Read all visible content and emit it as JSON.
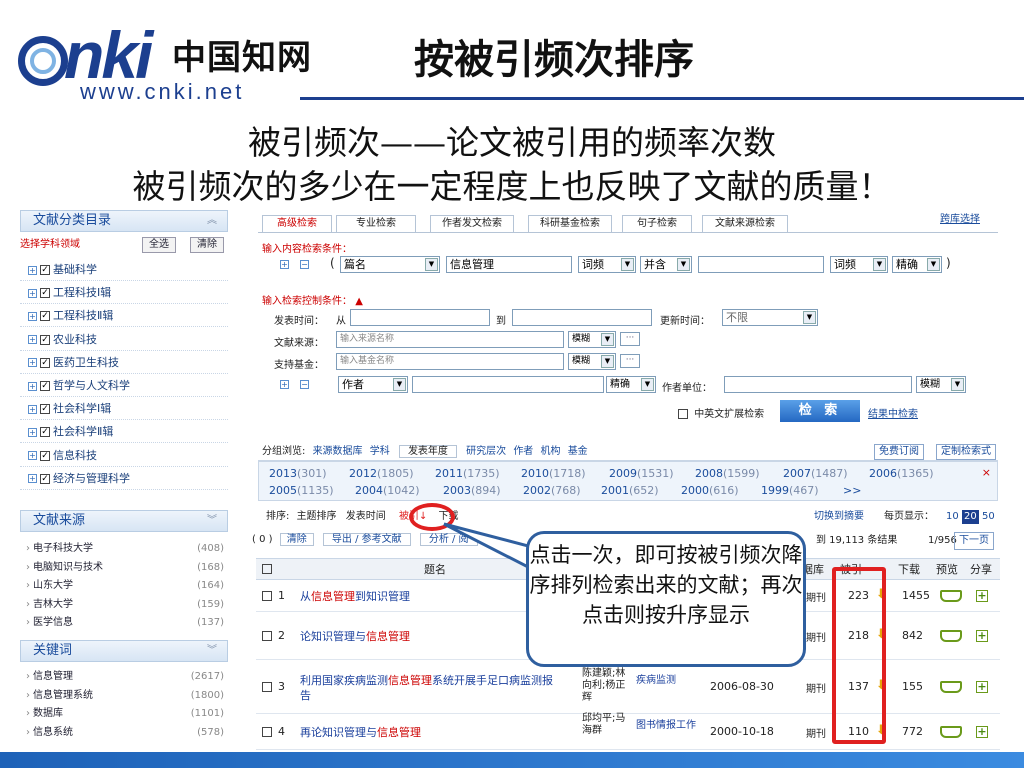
{
  "slide": {
    "logo_latin": "nki",
    "logo_chinese": "中国知网",
    "logo_url": "www.cnki.net",
    "title": "按被引频次排序",
    "subtitle_1": "被引频次——论文被引用的频率次数",
    "subtitle_2": "被引频次的多少在一定程度上也反映了文献的质量！",
    "callout": "点击一次，即可按被引频次降序排列检索出来的文献；再次点击则按升序显示"
  },
  "left_panel": {
    "category_title": "文献分类目录",
    "category_select_label": "选择学科领域",
    "select_all": "全选",
    "clear": "清除",
    "categories": [
      "基础科学",
      "工程科技Ⅰ辑",
      "工程科技Ⅱ辑",
      "农业科技",
      "医药卫生科技",
      "哲学与人文科学",
      "社会科学Ⅰ辑",
      "社会科学Ⅱ辑",
      "信息科技",
      "经济与管理科学"
    ],
    "source_title": "文献来源",
    "sources": [
      {
        "name": "电子科技大学",
        "count": "(408)"
      },
      {
        "name": "电脑知识与技术",
        "count": "(168)"
      },
      {
        "name": "山东大学",
        "count": "(164)"
      },
      {
        "name": "吉林大学",
        "count": "(159)"
      },
      {
        "name": "医学信息",
        "count": "(137)"
      }
    ],
    "keyword_title": "关键词",
    "keywords": [
      {
        "name": "信息管理",
        "count": "(2617)"
      },
      {
        "name": "信息管理系统",
        "count": "(1800)"
      },
      {
        "name": "数据库",
        "count": "(1101)"
      },
      {
        "name": "信息系统",
        "count": "(578)"
      }
    ]
  },
  "search": {
    "tabs": [
      "高级检索",
      "专业检索",
      "作者发文检索",
      "科研基金检索",
      "句子检索",
      "文献来源检索"
    ],
    "cross_db": "跨库选择",
    "content_label": "输入内容检索条件：",
    "paren_open": "(",
    "paren_close": ")",
    "field1": "篇名",
    "value1": "信息管理",
    "freq1": "词频",
    "logic": "并含",
    "freq2": "词频",
    "match": "精确",
    "control_label": "输入检索控制条件：",
    "pub_time_label": "发表时间：",
    "from_label": "从",
    "to_label": "到",
    "update_time_label": "更新时间：",
    "update_time_value": "不限",
    "source_label": "文献来源：",
    "source_placeholder": "输入来源名称",
    "fund_label": "支持基金：",
    "fund_placeholder": "输入基金名称",
    "fuzzy": "模糊",
    "author_field": "作者",
    "author_match": "精确",
    "author_unit_label": "作者单位：",
    "unit_match": "模糊",
    "cn_en_ext": "中英文扩展检索",
    "search_button": "检 索",
    "search_within": "结果中检索"
  },
  "group_browse": {
    "label": "分组浏览:",
    "items": [
      "来源数据库",
      "学科",
      "发表年度",
      "研究层次",
      "作者",
      "机构",
      "基金"
    ],
    "free_sub": "免费订阅",
    "custom": "定制检索式",
    "years_row1": [
      {
        "y": "2013",
        "n": "(301)"
      },
      {
        "y": "2012",
        "n": "(1805)"
      },
      {
        "y": "2011",
        "n": "(1735)"
      },
      {
        "y": "2010",
        "n": "(1718)"
      },
      {
        "y": "2009",
        "n": "(1531)"
      },
      {
        "y": "2008",
        "n": "(1599)"
      },
      {
        "y": "2007",
        "n": "(1487)"
      },
      {
        "y": "2006",
        "n": "(1365)"
      }
    ],
    "years_row2": [
      {
        "y": "2005",
        "n": "(1135)"
      },
      {
        "y": "2004",
        "n": "(1042)"
      },
      {
        "y": "2003",
        "n": "(894)"
      },
      {
        "y": "2002",
        "n": "(768)"
      },
      {
        "y": "2001",
        "n": "(652)"
      },
      {
        "y": "2000",
        "n": "(616)"
      },
      {
        "y": "1999",
        "n": "(467)"
      }
    ],
    "more": ">>",
    "close": "×"
  },
  "sort": {
    "label": "排序:",
    "topic": "主题排序",
    "pub_time": "发表时间",
    "cited": "被引",
    "download": "下载",
    "switch_abstract": "切换到摘要",
    "per_page_label": "每页显示：",
    "per_page": [
      "10",
      "20",
      "50"
    ],
    "per_page_active": "20"
  },
  "toolbar": {
    "selected_count": "( 0 )",
    "clear": "清除",
    "export": "导出 / 参考文献",
    "analyze": "分析 / 阅",
    "result_count": "找到 19,113 条结果",
    "result_count_shown": "到 19,113 条结果",
    "pages": "1/956",
    "next": "下一页"
  },
  "table": {
    "headers": {
      "title": "题名",
      "db": "据库",
      "cited": "被引",
      "download": "下载",
      "preview": "预览",
      "share": "分享"
    },
    "rows": [
      {
        "idx": "1",
        "title_pre": "从",
        "title_hl": "信息管理",
        "title_post": "到知识管理",
        "author": "",
        "source": "",
        "date": "",
        "db": "期刊",
        "cited": "223",
        "download": "1455"
      },
      {
        "idx": "2",
        "title_pre": "论知识管理与",
        "title_hl": "信息管理",
        "title_post": "",
        "author": "",
        "source": "",
        "date": "",
        "db": "期刊",
        "cited": "218",
        "download": "842"
      },
      {
        "idx": "3",
        "title_pre": "利用国家疾病监测",
        "title_hl": "信息管理",
        "title_post": "系统开展手足口病监测报告",
        "author": "陈建颖;林向利;杨正辉",
        "source": "疾病监测",
        "date": "2006-08-30",
        "db": "期刊",
        "cited": "137",
        "download": "155"
      },
      {
        "idx": "4",
        "title_pre": "再论知识管理与",
        "title_hl": "信息管理",
        "title_post": "",
        "author": "邱均平;马海群",
        "source": "图书情报工作",
        "date": "2000-10-18",
        "db": "期刊",
        "cited": "110",
        "download": "772"
      }
    ]
  },
  "colors": {
    "brand_blue": "#1c3f8f",
    "highlight_red": "#e02020",
    "link_blue": "#1a4c9c"
  }
}
